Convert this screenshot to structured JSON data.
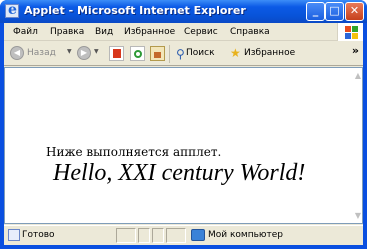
{
  "window": {
    "title": "Applet - Microsoft Internet Explorer",
    "minimize_glyph": "_",
    "maximize_glyph": "□",
    "close_glyph": "✕"
  },
  "menu": {
    "items": [
      "Файл",
      "Правка",
      "Вид",
      "Избранное",
      "Сервис",
      "Справка"
    ]
  },
  "toolbar": {
    "back_label": "Назад",
    "search_label": "Поиск",
    "favorites_label": "Избранное",
    "more_glyph": "»"
  },
  "content": {
    "caption": "Ниже выполняется апплет.",
    "applet_text": "Hello, XXI century World!"
  },
  "status": {
    "text": "Готово",
    "zone": "Мой компьютер"
  }
}
